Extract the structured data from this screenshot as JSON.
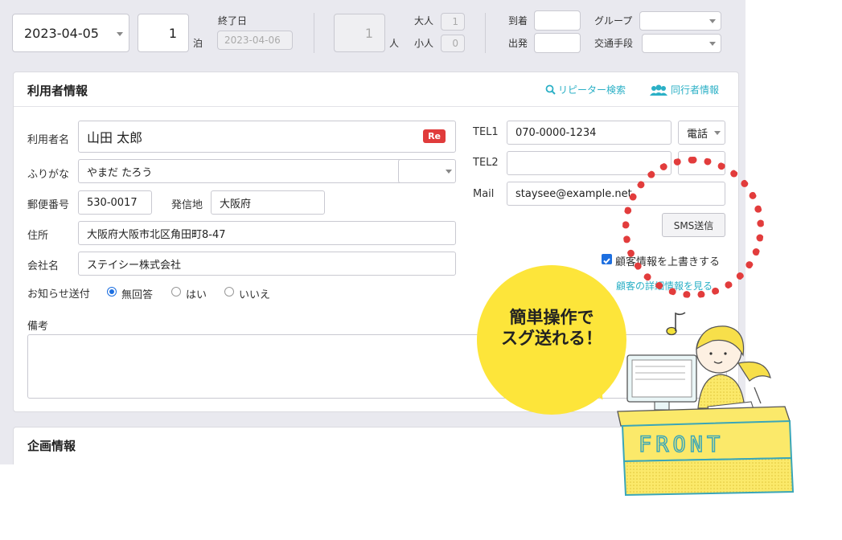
{
  "topbar": {
    "date": "2023-04-05",
    "nights": "1",
    "nights_unit": "泊",
    "end_date_label": "終了日",
    "end_date": "2023-04-06",
    "guests": "1",
    "guests_unit": "人",
    "adult_label": "大人",
    "adult_count": "1",
    "child_label": "小人",
    "child_count": "0",
    "arrival_label": "到着",
    "departure_label": "出発",
    "group_label": "グループ",
    "transport_label": "交通手段"
  },
  "user_info": {
    "title": "利用者情報",
    "repeater_search": "リピーター検索",
    "companion_info": "同行者情報",
    "name_label": "利用者名",
    "name_value": "山田 太郎",
    "re_badge": "Re",
    "kana_label": "ふりがな",
    "kana_value": "やまだ たろう",
    "postal_label": "郵便番号",
    "postal_value": "530-0017",
    "origin_label": "発信地",
    "origin_value": "大阪府",
    "address_label": "住所",
    "address_value": "大阪府大阪市北区角田町8-47",
    "company_label": "会社名",
    "company_value": "ステイシー株式会社",
    "notice_label": "お知らせ送付",
    "notice_options": [
      "無回答",
      "はい",
      "いいえ"
    ],
    "notes_label": "備考",
    "tel1_label": "TEL1",
    "tel1_value": "070-0000-1234",
    "tel1_type": "電話",
    "tel2_label": "TEL2",
    "mail_label": "Mail",
    "mail_value": "staysee@example.net",
    "sms_button": "SMS送信",
    "overwrite_label": "顧客情報を上書きする",
    "detail_link": "顧客の詳細情報を見る"
  },
  "plan_info": {
    "title": "企画情報"
  },
  "promo": {
    "line1": "簡単操作で",
    "line2": "スグ送れる！",
    "sign": "FRONT"
  },
  "colors": {
    "accent": "#2bb0c6",
    "badge": "#e03b3b",
    "bubble": "#fde53a",
    "ring": "#e23c3c"
  }
}
